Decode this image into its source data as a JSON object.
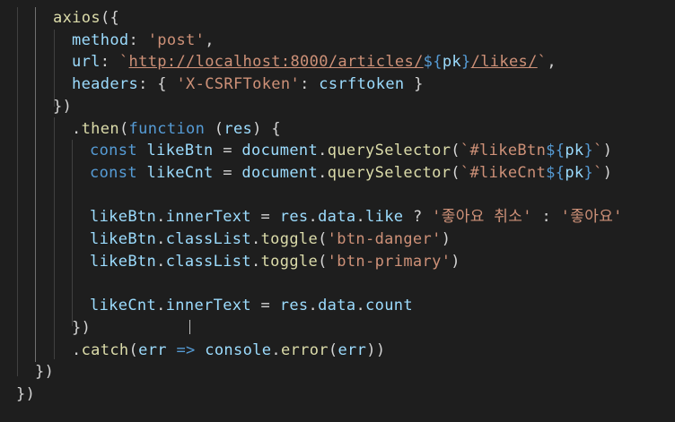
{
  "editor": {
    "colors": {
      "background": "#1e1e1e",
      "function": "#dcdcaa",
      "variable": "#9cdcfe",
      "string": "#ce9178",
      "keyword": "#569cd6",
      "plain": "#d4d4d4"
    },
    "lines": [
      {
        "segments": [
          {
            "t": "axios",
            "c": "fn"
          },
          {
            "t": "({",
            "c": "pl"
          }
        ]
      },
      {
        "segments": [
          {
            "t": "method",
            "c": "var"
          },
          {
            "t": ": ",
            "c": "pl"
          },
          {
            "t": "'post'",
            "c": "str"
          },
          {
            "t": ",",
            "c": "pl"
          }
        ]
      },
      {
        "segments": [
          {
            "t": "url",
            "c": "var"
          },
          {
            "t": ": ",
            "c": "pl"
          },
          {
            "t": "`",
            "c": "str"
          },
          {
            "t": "http://localhost:8000/articles/",
            "c": "url"
          },
          {
            "t": "${",
            "c": "tpl"
          },
          {
            "t": "pk",
            "c": "var"
          },
          {
            "t": "}",
            "c": "tpl"
          },
          {
            "t": "/likes/",
            "c": "url"
          },
          {
            "t": "`",
            "c": "str"
          },
          {
            "t": ",",
            "c": "pl"
          }
        ]
      },
      {
        "segments": [
          {
            "t": "headers",
            "c": "var"
          },
          {
            "t": ": { ",
            "c": "pl"
          },
          {
            "t": "'X-CSRFToken'",
            "c": "str"
          },
          {
            "t": ": ",
            "c": "pl"
          },
          {
            "t": "csrftoken",
            "c": "var"
          },
          {
            "t": " }",
            "c": "pl"
          }
        ]
      },
      {
        "segments": [
          {
            "t": "})",
            "c": "pl"
          }
        ]
      },
      {
        "segments": [
          {
            "t": ".",
            "c": "pl"
          },
          {
            "t": "then",
            "c": "fn"
          },
          {
            "t": "(",
            "c": "pl"
          },
          {
            "t": "function",
            "c": "kw"
          },
          {
            "t": " (",
            "c": "pl"
          },
          {
            "t": "res",
            "c": "var"
          },
          {
            "t": ") {",
            "c": "pl"
          }
        ]
      },
      {
        "segments": [
          {
            "t": "const",
            "c": "kw"
          },
          {
            "t": " ",
            "c": "pl"
          },
          {
            "t": "likeBtn",
            "c": "var"
          },
          {
            "t": " = ",
            "c": "pl"
          },
          {
            "t": "document",
            "c": "var"
          },
          {
            "t": ".",
            "c": "pl"
          },
          {
            "t": "querySelector",
            "c": "fn"
          },
          {
            "t": "(",
            "c": "pl"
          },
          {
            "t": "`#likeBtn",
            "c": "str"
          },
          {
            "t": "${",
            "c": "tpl"
          },
          {
            "t": "pk",
            "c": "var"
          },
          {
            "t": "}",
            "c": "tpl"
          },
          {
            "t": "`",
            "c": "str"
          },
          {
            "t": ")",
            "c": "pl"
          }
        ]
      },
      {
        "segments": [
          {
            "t": "const",
            "c": "kw"
          },
          {
            "t": " ",
            "c": "pl"
          },
          {
            "t": "likeCnt",
            "c": "var"
          },
          {
            "t": " = ",
            "c": "pl"
          },
          {
            "t": "document",
            "c": "var"
          },
          {
            "t": ".",
            "c": "pl"
          },
          {
            "t": "querySelector",
            "c": "fn"
          },
          {
            "t": "(",
            "c": "pl"
          },
          {
            "t": "`#likeCnt",
            "c": "str"
          },
          {
            "t": "${",
            "c": "tpl"
          },
          {
            "t": "pk",
            "c": "var"
          },
          {
            "t": "}",
            "c": "tpl"
          },
          {
            "t": "`",
            "c": "str"
          },
          {
            "t": ")",
            "c": "pl"
          }
        ]
      },
      {
        "segments": []
      },
      {
        "segments": [
          {
            "t": "likeBtn",
            "c": "var"
          },
          {
            "t": ".",
            "c": "pl"
          },
          {
            "t": "innerText",
            "c": "var"
          },
          {
            "t": " = ",
            "c": "pl"
          },
          {
            "t": "res",
            "c": "var"
          },
          {
            "t": ".",
            "c": "pl"
          },
          {
            "t": "data",
            "c": "var"
          },
          {
            "t": ".",
            "c": "pl"
          },
          {
            "t": "like",
            "c": "var"
          },
          {
            "t": " ? ",
            "c": "pl"
          },
          {
            "t": "'좋아요 취소'",
            "c": "str"
          },
          {
            "t": " : ",
            "c": "pl"
          },
          {
            "t": "'좋아요'",
            "c": "str"
          }
        ]
      },
      {
        "segments": [
          {
            "t": "likeBtn",
            "c": "var"
          },
          {
            "t": ".",
            "c": "pl"
          },
          {
            "t": "classList",
            "c": "var"
          },
          {
            "t": ".",
            "c": "pl"
          },
          {
            "t": "toggle",
            "c": "fn"
          },
          {
            "t": "(",
            "c": "pl"
          },
          {
            "t": "'btn-danger'",
            "c": "str"
          },
          {
            "t": ")",
            "c": "pl"
          }
        ]
      },
      {
        "segments": [
          {
            "t": "likeBtn",
            "c": "var"
          },
          {
            "t": ".",
            "c": "pl"
          },
          {
            "t": "classList",
            "c": "var"
          },
          {
            "t": ".",
            "c": "pl"
          },
          {
            "t": "toggle",
            "c": "fn"
          },
          {
            "t": "(",
            "c": "pl"
          },
          {
            "t": "'btn-primary'",
            "c": "str"
          },
          {
            "t": ")",
            "c": "pl"
          }
        ]
      },
      {
        "segments": []
      },
      {
        "segments": [
          {
            "t": "likeCnt",
            "c": "var"
          },
          {
            "t": ".",
            "c": "pl"
          },
          {
            "t": "innerText",
            "c": "var"
          },
          {
            "t": " = ",
            "c": "pl"
          },
          {
            "t": "res",
            "c": "var"
          },
          {
            "t": ".",
            "c": "pl"
          },
          {
            "t": "data",
            "c": "var"
          },
          {
            "t": ".",
            "c": "pl"
          },
          {
            "t": "count",
            "c": "var"
          }
        ]
      },
      {
        "segments": [
          {
            "t": "})",
            "c": "pl"
          }
        ]
      },
      {
        "segments": [
          {
            "t": ".",
            "c": "pl"
          },
          {
            "t": "catch",
            "c": "fn"
          },
          {
            "t": "(",
            "c": "pl"
          },
          {
            "t": "err",
            "c": "var"
          },
          {
            "t": " => ",
            "c": "kw"
          },
          {
            "t": "console",
            "c": "var"
          },
          {
            "t": ".",
            "c": "pl"
          },
          {
            "t": "error",
            "c": "fn"
          },
          {
            "t": "(",
            "c": "pl"
          },
          {
            "t": "err",
            "c": "var"
          },
          {
            "t": ")",
            "c": "pl"
          },
          {
            "t": ")",
            "c": "pl"
          }
        ]
      },
      {
        "segments": [
          {
            "t": "})",
            "c": "pl"
          }
        ]
      },
      {
        "segments": [
          {
            "t": "})",
            "c": "pl"
          }
        ]
      }
    ]
  }
}
